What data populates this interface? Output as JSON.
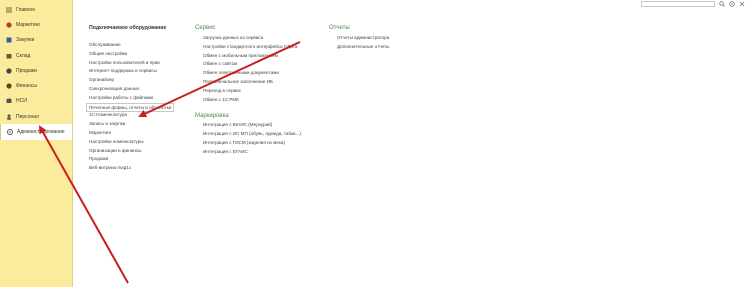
{
  "sidebar": {
    "items": [
      {
        "label": "Главное",
        "icon": "menu-icon"
      },
      {
        "label": "Маркетинг",
        "icon": "megaphone-icon"
      },
      {
        "label": "Закупки",
        "icon": "cart-icon"
      },
      {
        "label": "Склад",
        "icon": "box-icon"
      },
      {
        "label": "Продажи",
        "icon": "tag-icon"
      },
      {
        "label": "Финансы",
        "icon": "coin-icon"
      },
      {
        "label": "НСИ",
        "icon": "database-icon"
      },
      {
        "label": "Персонал",
        "icon": "person-icon"
      },
      {
        "label": "Администрирование",
        "icon": "gear-icon",
        "active": true
      }
    ]
  },
  "col1": {
    "title": "Подключаемое оборудование",
    "group1": [
      "Обслуживание",
      "Общие настройки",
      "Настройки пользователей и прав",
      "Интернет-поддержка и сервисы",
      "Органайзер",
      "Синхронизация данных",
      "Настройки работы с файлами",
      "Печатные формы, отчеты и обработки"
    ],
    "group2": [
      "1С:Номенклатура",
      "Запись и закупки",
      "Маркетинг",
      "Настройки номенклатуры",
      "Организации и финансы",
      "Продажи",
      "Веб-витрина mag1c"
    ]
  },
  "col2": {
    "title": "Сервис",
    "links": [
      "Загрузка данных из сервиса",
      "Настройки стандартного интерфейса ОДата",
      "Обмен с мобильным приложением",
      "Обмен с сайтом",
      "Обмен электронными документами",
      "Первоначальное заполнение ИБ",
      "Переход в сервис",
      "Обмен с 1С:РМК"
    ],
    "title2": "Маркировка",
    "links2": [
      "Интеграция с ВетИС (Меркурий)",
      "Интеграция с ИС МП (обувь, одежда, табак...)",
      "Интеграция с ГИСМ (изделия из меха)",
      "Интеграция с ЕГАИС"
    ]
  },
  "col3": {
    "title": "Отчеты",
    "links": [
      "Отчеты администратора",
      "Дополнительные отчеты"
    ]
  },
  "colors": {
    "sidebar_bg": "#fbeb9c",
    "accent_green": "#4e8a4e",
    "arrow": "#c81e1e"
  }
}
